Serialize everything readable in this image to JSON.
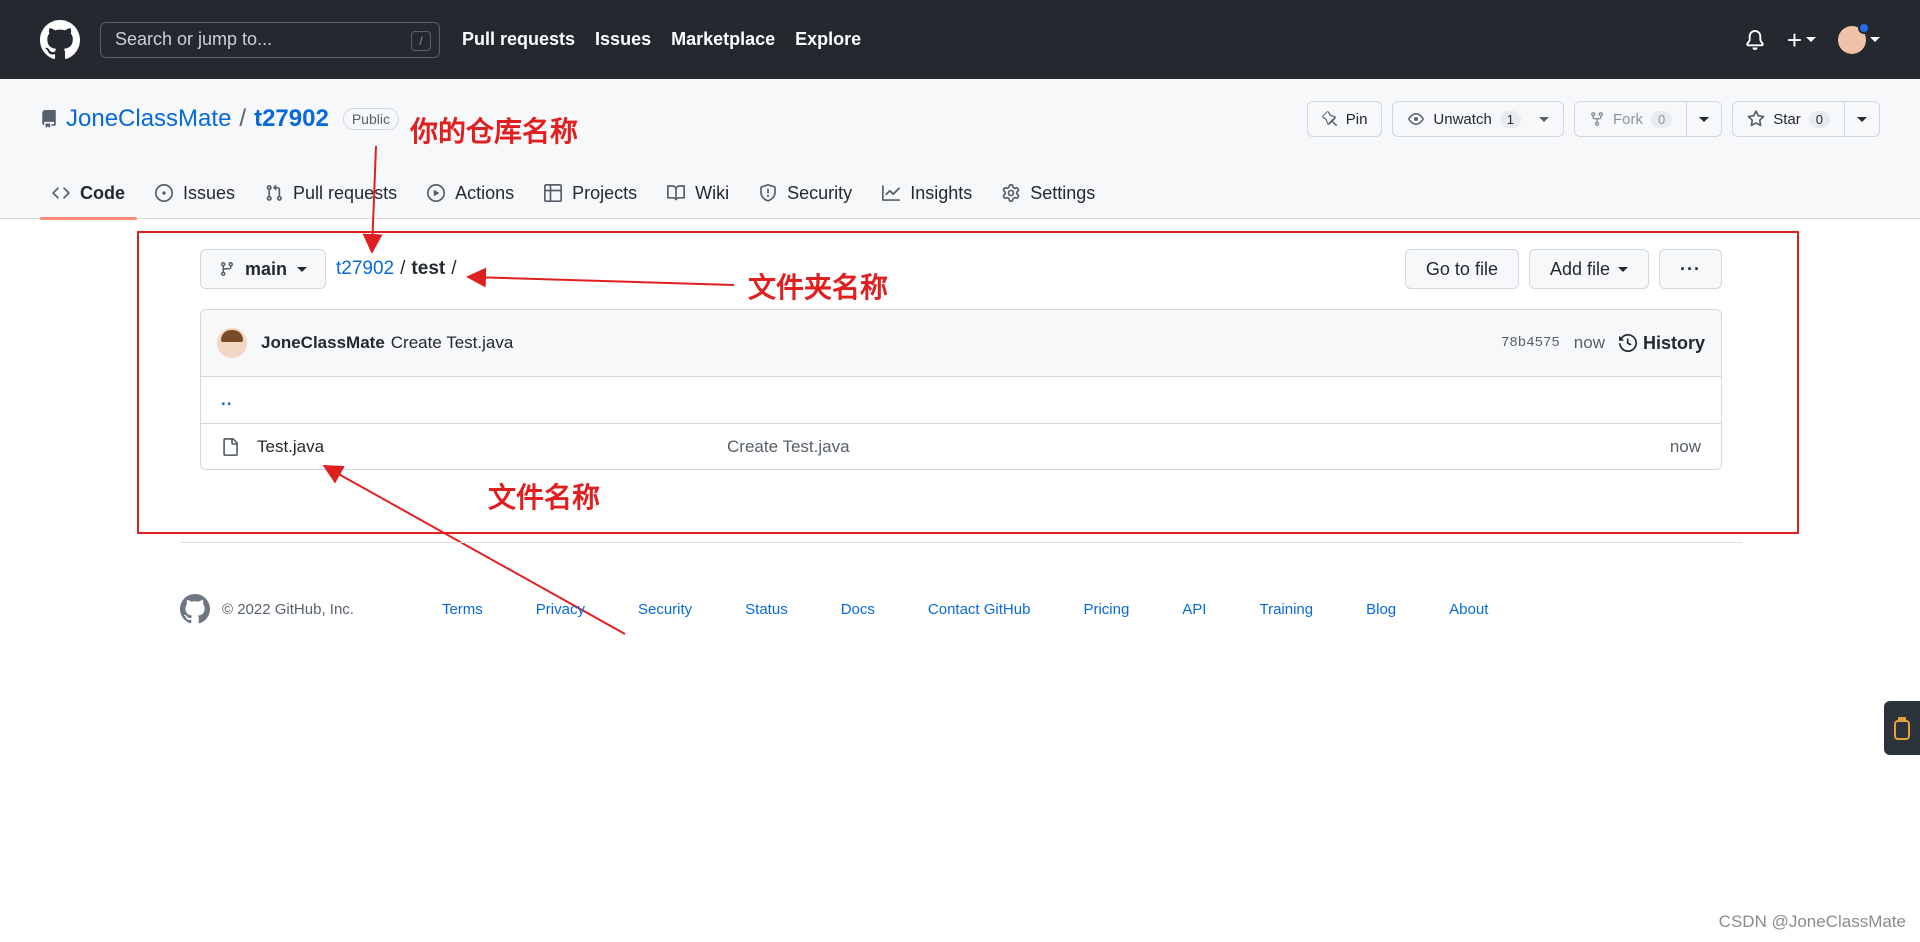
{
  "header": {
    "search_placeholder": "Search or jump to...",
    "search_shortcut": "/",
    "nav": [
      "Pull requests",
      "Issues",
      "Marketplace",
      "Explore"
    ],
    "plus_label": "+"
  },
  "repo": {
    "owner": "JoneClassMate",
    "separator": "/",
    "name": "t27902",
    "visibility": "Public",
    "actions": {
      "pin": "Pin",
      "unwatch": "Unwatch",
      "unwatch_count": "1",
      "fork": "Fork",
      "fork_count": "0",
      "star": "Star",
      "star_count": "0"
    },
    "tabs": [
      "Code",
      "Issues",
      "Pull requests",
      "Actions",
      "Projects",
      "Wiki",
      "Security",
      "Insights",
      "Settings"
    ]
  },
  "file_nav": {
    "branch": "main",
    "crumb_root": "t27902",
    "crumb_sep": "/",
    "crumb_current": "test",
    "crumb_trail": "/",
    "go_to_file": "Go to file",
    "add_file": "Add file",
    "more": "···"
  },
  "commit": {
    "author": "JoneClassMate",
    "message": "Create Test.java",
    "sha": "78b4575",
    "age": "now",
    "history": "History"
  },
  "files": {
    "up": "..",
    "rows": [
      {
        "name": "Test.java",
        "message": "Create Test.java",
        "age": "now"
      }
    ]
  },
  "annotations": {
    "repo_name": "你的仓库名称",
    "folder_name": "文件夹名称",
    "file_name": "文件名称"
  },
  "footer": {
    "copyright": "© 2022 GitHub, Inc.",
    "links": [
      "Terms",
      "Privacy",
      "Security",
      "Status",
      "Docs",
      "Contact GitHub",
      "Pricing",
      "API",
      "Training",
      "Blog",
      "About"
    ]
  },
  "watermark": "CSDN @JoneClassMate",
  "colors": {
    "header_bg": "#24292f",
    "link": "#0969da",
    "annotation": "#e02020",
    "tab_underline": "#fd8c73"
  }
}
